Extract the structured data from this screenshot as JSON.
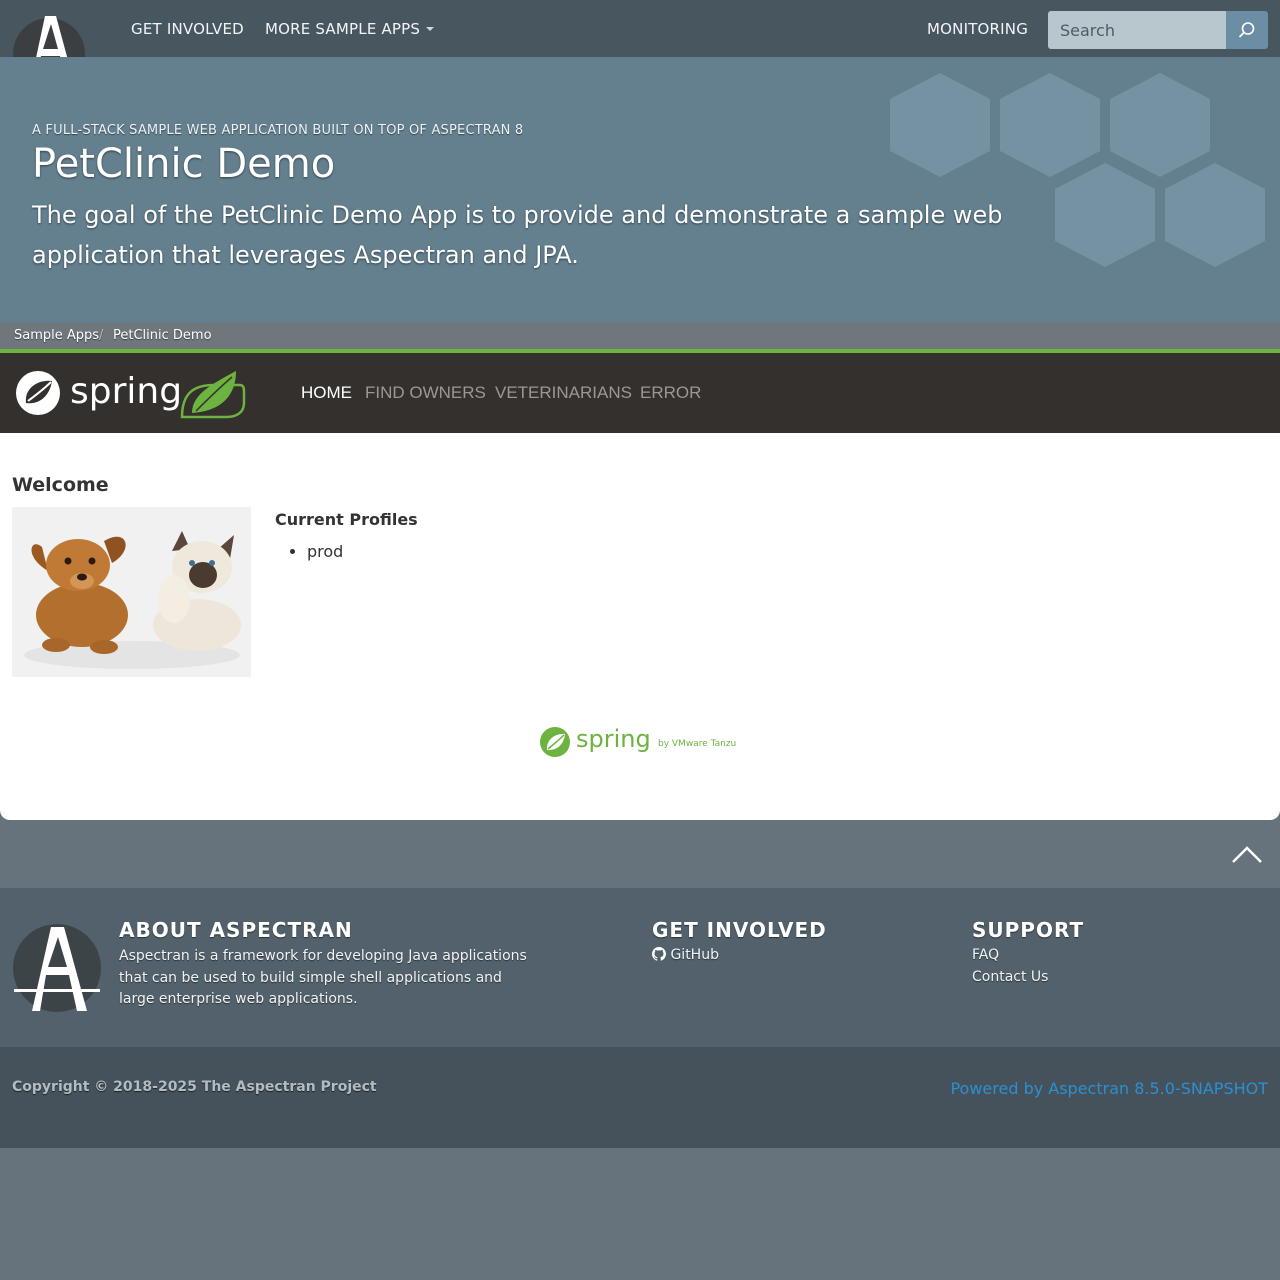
{
  "topnav": {
    "links": [
      "GET INVOLVED",
      "MORE SAMPLE APPS",
      "MONITORING"
    ],
    "search_placeholder": "Search"
  },
  "hero": {
    "kicker": "A FULL-STACK SAMPLE WEB APPLICATION BUILT ON TOP OF ASPECTRAN 8",
    "title": "PetClinic Demo",
    "description": "The goal of the PetClinic Demo App is to provide and demonstrate a sample web application that leverages Aspectran and JPA."
  },
  "breadcrumb": {
    "items": [
      "Sample Apps",
      "PetClinic Demo"
    ],
    "separator": "/"
  },
  "spring_nav": {
    "logo_text": "spring",
    "items": [
      "HOME",
      "FIND OWNERS",
      "VETERINARIANS",
      "ERROR"
    ],
    "active": "HOME"
  },
  "main": {
    "heading": "Welcome",
    "profiles_title": "Current Profiles",
    "profiles": [
      "prod"
    ],
    "footer_logo_text": "spring",
    "footer_logo_sub": "by VMware Tanzu"
  },
  "footer": {
    "about": {
      "title": "ABOUT ASPECTRAN",
      "text": "Aspectran is a framework for developing Java applications that can be used to build simple shell applications and large enterprise web applications."
    },
    "get_involved": {
      "title": "GET INVOLVED",
      "links": [
        "GitHub"
      ]
    },
    "support": {
      "title": "SUPPORT",
      "links": [
        "FAQ",
        "Contact Us"
      ]
    },
    "copyright": "Copyright © 2018-2025 The Aspectran Project",
    "powered_by": "Powered by Aspectran 8.5.0-SNAPSHOT"
  },
  "colors": {
    "topbar": "#48565f",
    "hero": "#64808f",
    "spring_green": "#6db33f",
    "spring_nav": "#34302d",
    "footer": "#52616b",
    "link_blue": "#2c8fd1"
  },
  "icons": [
    "aspectran-logo",
    "chevron-down-icon",
    "search-icon",
    "spring-logo",
    "pets-photo",
    "chevron-up-icon",
    "github-icon"
  ]
}
